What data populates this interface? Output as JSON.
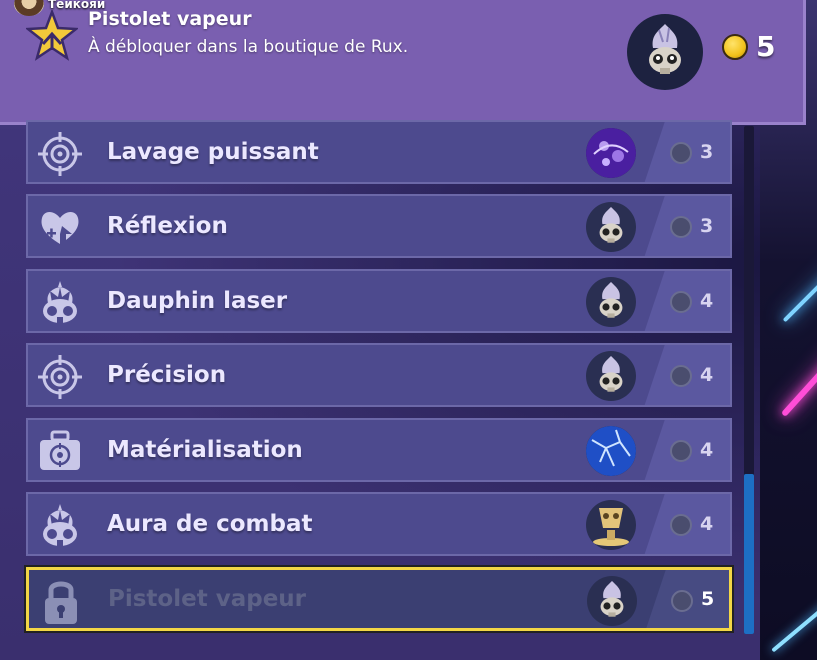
{
  "player": {
    "name": "Теикояи"
  },
  "header": {
    "title": "Pistolet vapeur",
    "subtitle": "À débloquer dans la boutique de Rux.",
    "star_icon": "star-unlock-icon",
    "portrait_icon": "character-portrait-icon",
    "coin_count": "5",
    "coin_color": "#f2c21b"
  },
  "skills": [
    {
      "label": "Lavage puissant",
      "icon": "target-icon",
      "thumb": "purple-swirl-icon",
      "cost": "3",
      "locked": false
    },
    {
      "label": "Réflexion",
      "icon": "heart-shield-icon",
      "thumb": "character-portrait-icon",
      "cost": "3",
      "locked": false
    },
    {
      "label": "Dauphin laser",
      "icon": "skull-icon",
      "thumb": "character-portrait-icon",
      "cost": "4",
      "locked": false
    },
    {
      "label": "Précision",
      "icon": "target-icon",
      "thumb": "character-portrait-icon",
      "cost": "4",
      "locked": false
    },
    {
      "label": "Matérialisation",
      "icon": "briefcase-target-icon",
      "thumb": "blue-crack-icon",
      "cost": "4",
      "locked": false
    },
    {
      "label": "Aura de combat",
      "icon": "skull-icon",
      "thumb": "golden-trophy-icon",
      "cost": "4",
      "locked": false
    },
    {
      "label": "Pistolet vapeur",
      "icon": "padlock-icon",
      "thumb": "character-portrait-icon",
      "cost": "5",
      "locked": true
    }
  ],
  "colors": {
    "accent": "#f3d646",
    "panel": "#7a5fb0",
    "row": "#4d4a8e",
    "scroll": "#1d6fc4"
  }
}
